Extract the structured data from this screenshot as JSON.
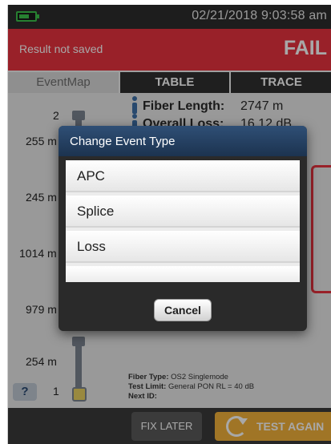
{
  "status_bar": {
    "datetime": "02/21/2018 9:03:58 am",
    "battery_icon": "battery-icon"
  },
  "result": {
    "saved_text": "Result not saved",
    "status": "FAIL",
    "status_color": "#e8333f"
  },
  "tabs": [
    {
      "label": "EventMap"
    },
    {
      "label": "TABLE"
    },
    {
      "label": "TRACE"
    }
  ],
  "summary": {
    "fiber_length_label": "Fiber Length:",
    "fiber_length_value": "2747 m",
    "overall_loss_label": "Overall Loss:",
    "overall_loss_value": "16.12 dB"
  },
  "event_map": {
    "start_number": "2",
    "end_number": "1",
    "distances": [
      "255 m",
      "245 m",
      "1014 m",
      "979 m",
      "254 m"
    ]
  },
  "help_label": "?",
  "fiber_info": {
    "type_label": "Fiber Type:",
    "type_value": "OS2 Singlemode",
    "limit_label": "Test Limit:",
    "limit_value": "General PON RL = 40 dB",
    "next_id_label": "Next ID:"
  },
  "bottom_bar": {
    "fix_later": "FIX LATER",
    "test_again": "TEST AGAIN",
    "accent_color": "#f3b23a"
  },
  "dialog": {
    "title": "Change Event Type",
    "options": [
      "APC",
      "Splice",
      "Loss"
    ],
    "cancel": "Cancel"
  }
}
